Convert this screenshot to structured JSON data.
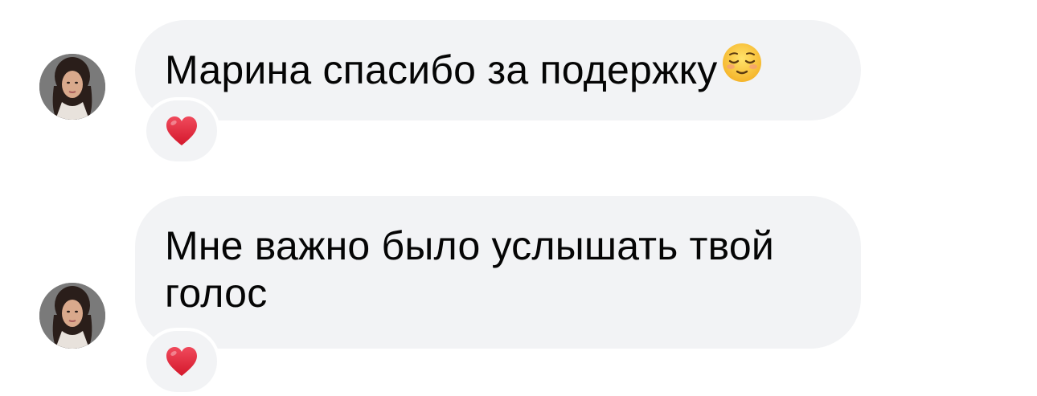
{
  "messages": [
    {
      "text": "Марина спасибо за подержку",
      "inline_emoji": "relieved-face",
      "reaction": "red-heart",
      "avatar": "user-avatar"
    },
    {
      "text": "Мне важно было услышать твой голос",
      "reaction": "red-heart",
      "avatar": "user-avatar"
    }
  ],
  "colors": {
    "bubble_bg": "#f2f3f5",
    "text": "#050505",
    "heart": "#e0243b",
    "emoji_face": "#ffc93a"
  }
}
